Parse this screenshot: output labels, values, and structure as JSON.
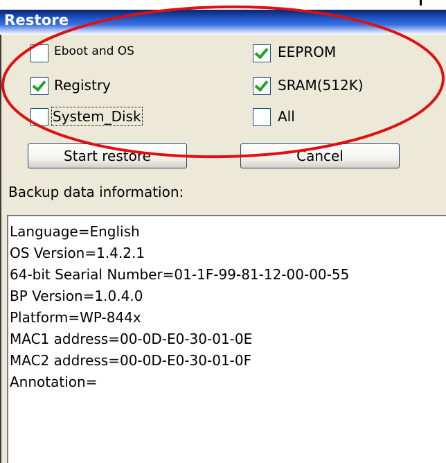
{
  "window": {
    "title": "Restore"
  },
  "options": [
    {
      "label": "Eboot and OS",
      "checked": false
    },
    {
      "label": "EEPROM",
      "checked": true
    },
    {
      "label": "Registry",
      "checked": true
    },
    {
      "label": "SRAM(512K)",
      "checked": true
    },
    {
      "label": "System_Disk",
      "checked": false
    },
    {
      "label": "All",
      "checked": false
    }
  ],
  "buttons": {
    "start_restore": "Start restore",
    "cancel": "Cancel"
  },
  "backup_info": {
    "label": "Backup data information:",
    "lines": [
      "Language=English",
      "OS Version=1.4.2.1",
      "64-bit Searial Number=01-1F-99-81-12-00-00-55",
      "BP Version=1.0.4.0",
      "Platform=WP-844x",
      "MAC1 address=00-0D-E0-30-01-0E",
      "MAC2 address=00-0D-E0-30-01-0F",
      "Annotation="
    ]
  },
  "colors": {
    "title_bar": "#1e56c8",
    "dialog_bg": "#ece9d8",
    "check_mark": "#21a121",
    "annotation_ellipse": "#e01010"
  }
}
